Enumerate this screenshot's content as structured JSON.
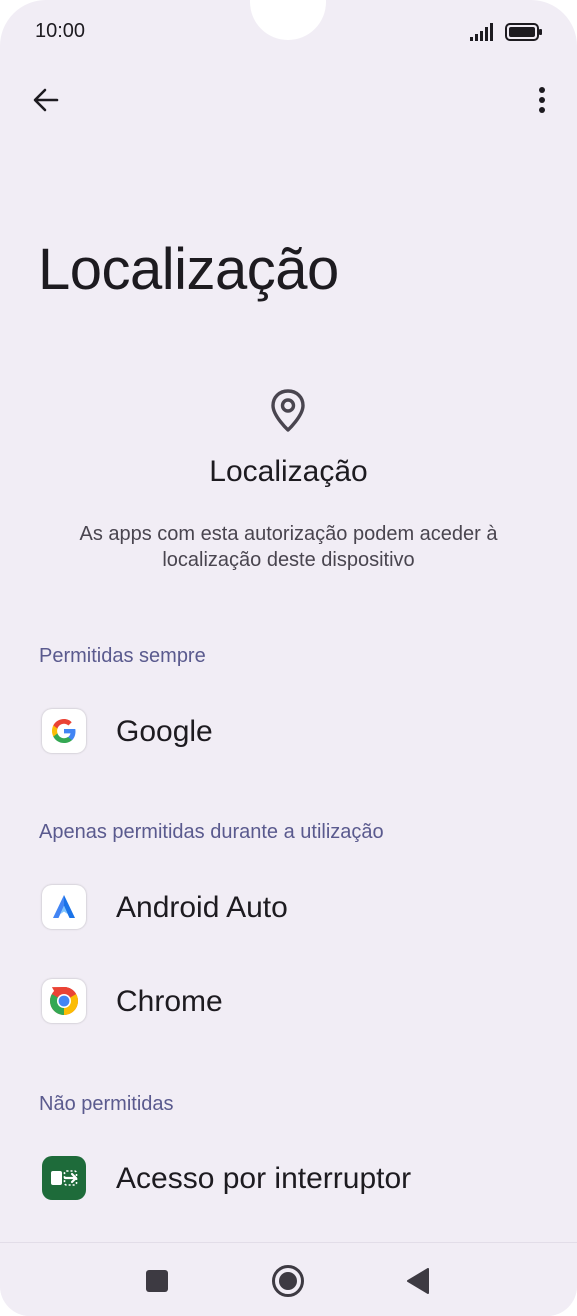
{
  "status_bar": {
    "time": "10:00"
  },
  "header": {
    "title": "Localização"
  },
  "hero": {
    "title": "Localização",
    "description": "As apps com esta autorização podem aceder à localização deste dispositivo"
  },
  "sections": [
    {
      "header": "Permitidas sempre",
      "apps": [
        {
          "name": "Google",
          "icon": "google-icon"
        }
      ]
    },
    {
      "header": "Apenas permitidas durante a utilização",
      "apps": [
        {
          "name": "Android Auto",
          "icon": "android-auto-icon"
        },
        {
          "name": "Chrome",
          "icon": "chrome-icon"
        }
      ]
    },
    {
      "header": "Não permitidas",
      "apps": [
        {
          "name": "Acesso por interruptor",
          "icon": "switch-access-icon"
        }
      ]
    }
  ],
  "colors": {
    "background": "#f1edf5",
    "section_header": "#5a5a8e",
    "text": "#1d1b20"
  }
}
